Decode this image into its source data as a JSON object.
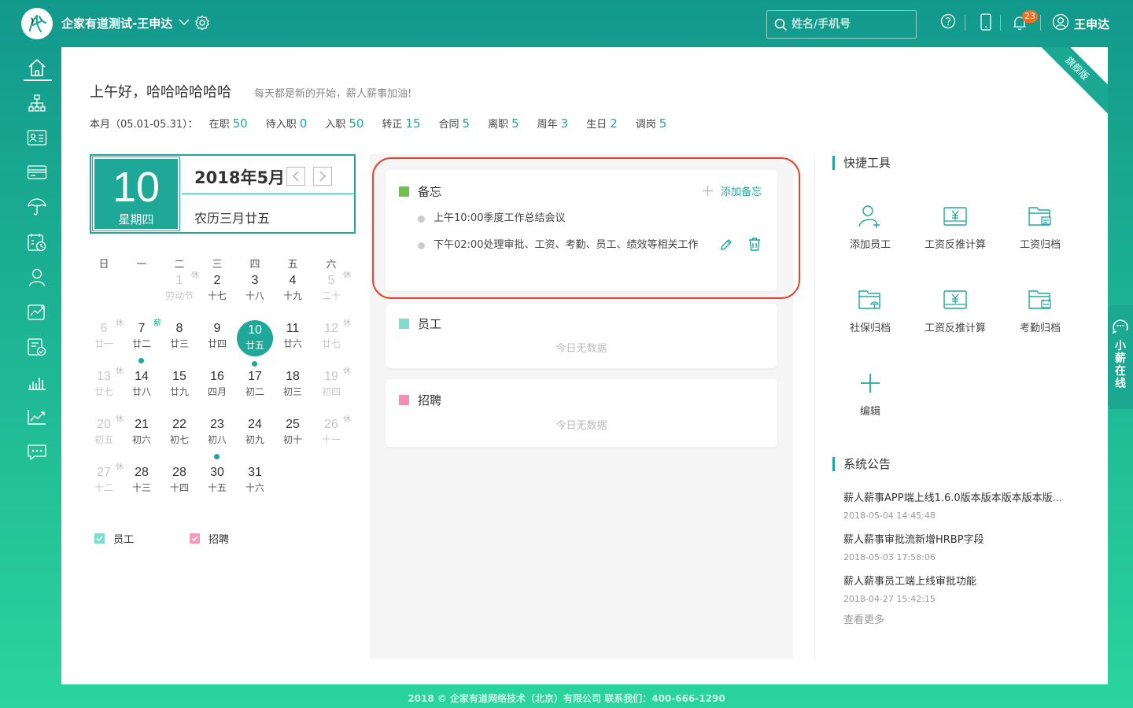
{
  "topbar": {
    "org_name": "企家有道测试-王申达",
    "search_placeholder": "姓名/手机号",
    "notification_count": "23",
    "user_name": "王申达"
  },
  "sidebar": {
    "items": [
      {
        "icon": "home-icon"
      },
      {
        "icon": "org-chart-icon"
      },
      {
        "icon": "id-card-icon"
      },
      {
        "icon": "salary-card-icon"
      },
      {
        "icon": "umbrella-icon"
      },
      {
        "icon": "attendance-icon"
      },
      {
        "icon": "user-icon"
      },
      {
        "icon": "performance-icon"
      },
      {
        "icon": "approval-icon"
      },
      {
        "icon": "bar-chart-icon"
      },
      {
        "icon": "trend-chart-icon"
      },
      {
        "icon": "message-icon"
      }
    ]
  },
  "ribbon": "旗舰版",
  "greeting": {
    "title": "上午好，哈哈哈哈哈哈",
    "subtitle": "每天都是新的开始，薪人薪事加油!"
  },
  "stats": {
    "period": "本月（05.01-05.31）：",
    "items": [
      {
        "label": "在职",
        "value": "50"
      },
      {
        "label": "待入职",
        "value": "0"
      },
      {
        "label": "入职",
        "value": "50"
      },
      {
        "label": "转正",
        "value": "15"
      },
      {
        "label": "合同",
        "value": "5"
      },
      {
        "label": "离职",
        "value": "5"
      },
      {
        "label": "周年",
        "value": "3"
      },
      {
        "label": "生日",
        "value": "2"
      },
      {
        "label": "调岗",
        "value": "5"
      }
    ]
  },
  "calendar": {
    "today_num": "10",
    "today_weekday": "星期四",
    "month_title": "2018年5月",
    "lunar": "农历三月廿五",
    "weekdays": [
      "日",
      "一",
      "二",
      "三",
      "四",
      "五",
      "六"
    ],
    "days": [
      {
        "n": "1",
        "l": "劳动节",
        "off": true,
        "tag": "休"
      },
      {
        "n": "2",
        "l": "十七"
      },
      {
        "n": "3",
        "l": "十八"
      },
      {
        "n": "4",
        "l": "十九"
      },
      {
        "n": "5",
        "l": "二十",
        "off": true,
        "tag": "休"
      },
      {
        "n": "6",
        "l": "廿一",
        "off": true,
        "tag": "休"
      },
      {
        "n": "7",
        "l": "廿二",
        "tag": "薪",
        "pay": true,
        "dot": true
      },
      {
        "n": "8",
        "l": "廿三"
      },
      {
        "n": "9",
        "l": "廿四"
      },
      {
        "n": "10",
        "l": "廿五",
        "today": true,
        "dot": true
      },
      {
        "n": "11",
        "l": "廿六"
      },
      {
        "n": "12",
        "l": "廿七",
        "off": true,
        "tag": "休"
      },
      {
        "n": "13",
        "l": "廿七",
        "off": true,
        "tag": "休"
      },
      {
        "n": "14",
        "l": "廿八"
      },
      {
        "n": "15",
        "l": "廿九"
      },
      {
        "n": "16",
        "l": "四月"
      },
      {
        "n": "17",
        "l": "初二"
      },
      {
        "n": "18",
        "l": "初三"
      },
      {
        "n": "19",
        "l": "初四",
        "off": true,
        "tag": "休"
      },
      {
        "n": "20",
        "l": "初五",
        "off": true,
        "tag": "休"
      },
      {
        "n": "21",
        "l": "初六"
      },
      {
        "n": "22",
        "l": "初七"
      },
      {
        "n": "23",
        "l": "初八",
        "dot": true
      },
      {
        "n": "24",
        "l": "初九"
      },
      {
        "n": "25",
        "l": "初十"
      },
      {
        "n": "26",
        "l": "十一",
        "off": true,
        "tag": "休"
      },
      {
        "n": "27",
        "l": "十二",
        "off": true,
        "tag": "休"
      },
      {
        "n": "28",
        "l": "十三"
      },
      {
        "n": "28",
        "l": "十四"
      },
      {
        "n": "30",
        "l": "十五"
      },
      {
        "n": "31",
        "l": "十六"
      }
    ],
    "legend": [
      {
        "label": "员工",
        "color": "#7fdccf"
      },
      {
        "label": "招聘",
        "color": "#f59ab8"
      }
    ]
  },
  "memo": {
    "title": "备忘",
    "color": "#6cc24a",
    "add_label": "添加备忘",
    "items": [
      {
        "text": "上午10:00季度工作总结会议"
      },
      {
        "text": "下午02:00处理审批、工资、考勤、员工、绩效等相关工作"
      }
    ]
  },
  "employee_card": {
    "title": "员工",
    "color": "#7fdccf",
    "empty": "今日无数据"
  },
  "recruit_card": {
    "title": "招聘",
    "color": "#f58fb1",
    "empty": "今日无数据"
  },
  "tools": {
    "title": "快捷工具",
    "items": [
      {
        "label": "添加员工",
        "icon": "add-user-icon"
      },
      {
        "label": "工资反推计算",
        "icon": "salary-calc-icon"
      },
      {
        "label": "工资归档",
        "icon": "salary-archive-icon"
      },
      {
        "label": "社保归档",
        "icon": "social-archive-icon"
      },
      {
        "label": "工资反推计算",
        "icon": "salary-calc-icon"
      },
      {
        "label": "考勤归档",
        "icon": "attendance-archive-icon"
      },
      {
        "label": "编辑",
        "icon": "plus-icon"
      }
    ]
  },
  "notices": {
    "title": "系统公告",
    "items": [
      {
        "title": "薪人薪事APP端上线1.6.0版本版本版本版本版...",
        "date": "2018-05-04 14:45:48"
      },
      {
        "title": "薪人薪事审批流新增HRBP字段",
        "date": "2018-05-03 17:58:06"
      },
      {
        "title": "薪人薪事员工端上线审批功能",
        "date": "2018-04-27 15:42:15"
      }
    ],
    "more": "查看更多"
  },
  "helper": {
    "label": "小薪在线"
  },
  "footer": "2018 © 企家有道网络技术（北京）有限公司    联系我们：400-666-1290",
  "colors": {
    "accent": "#1fa898",
    "highlight": "#e9432f"
  }
}
